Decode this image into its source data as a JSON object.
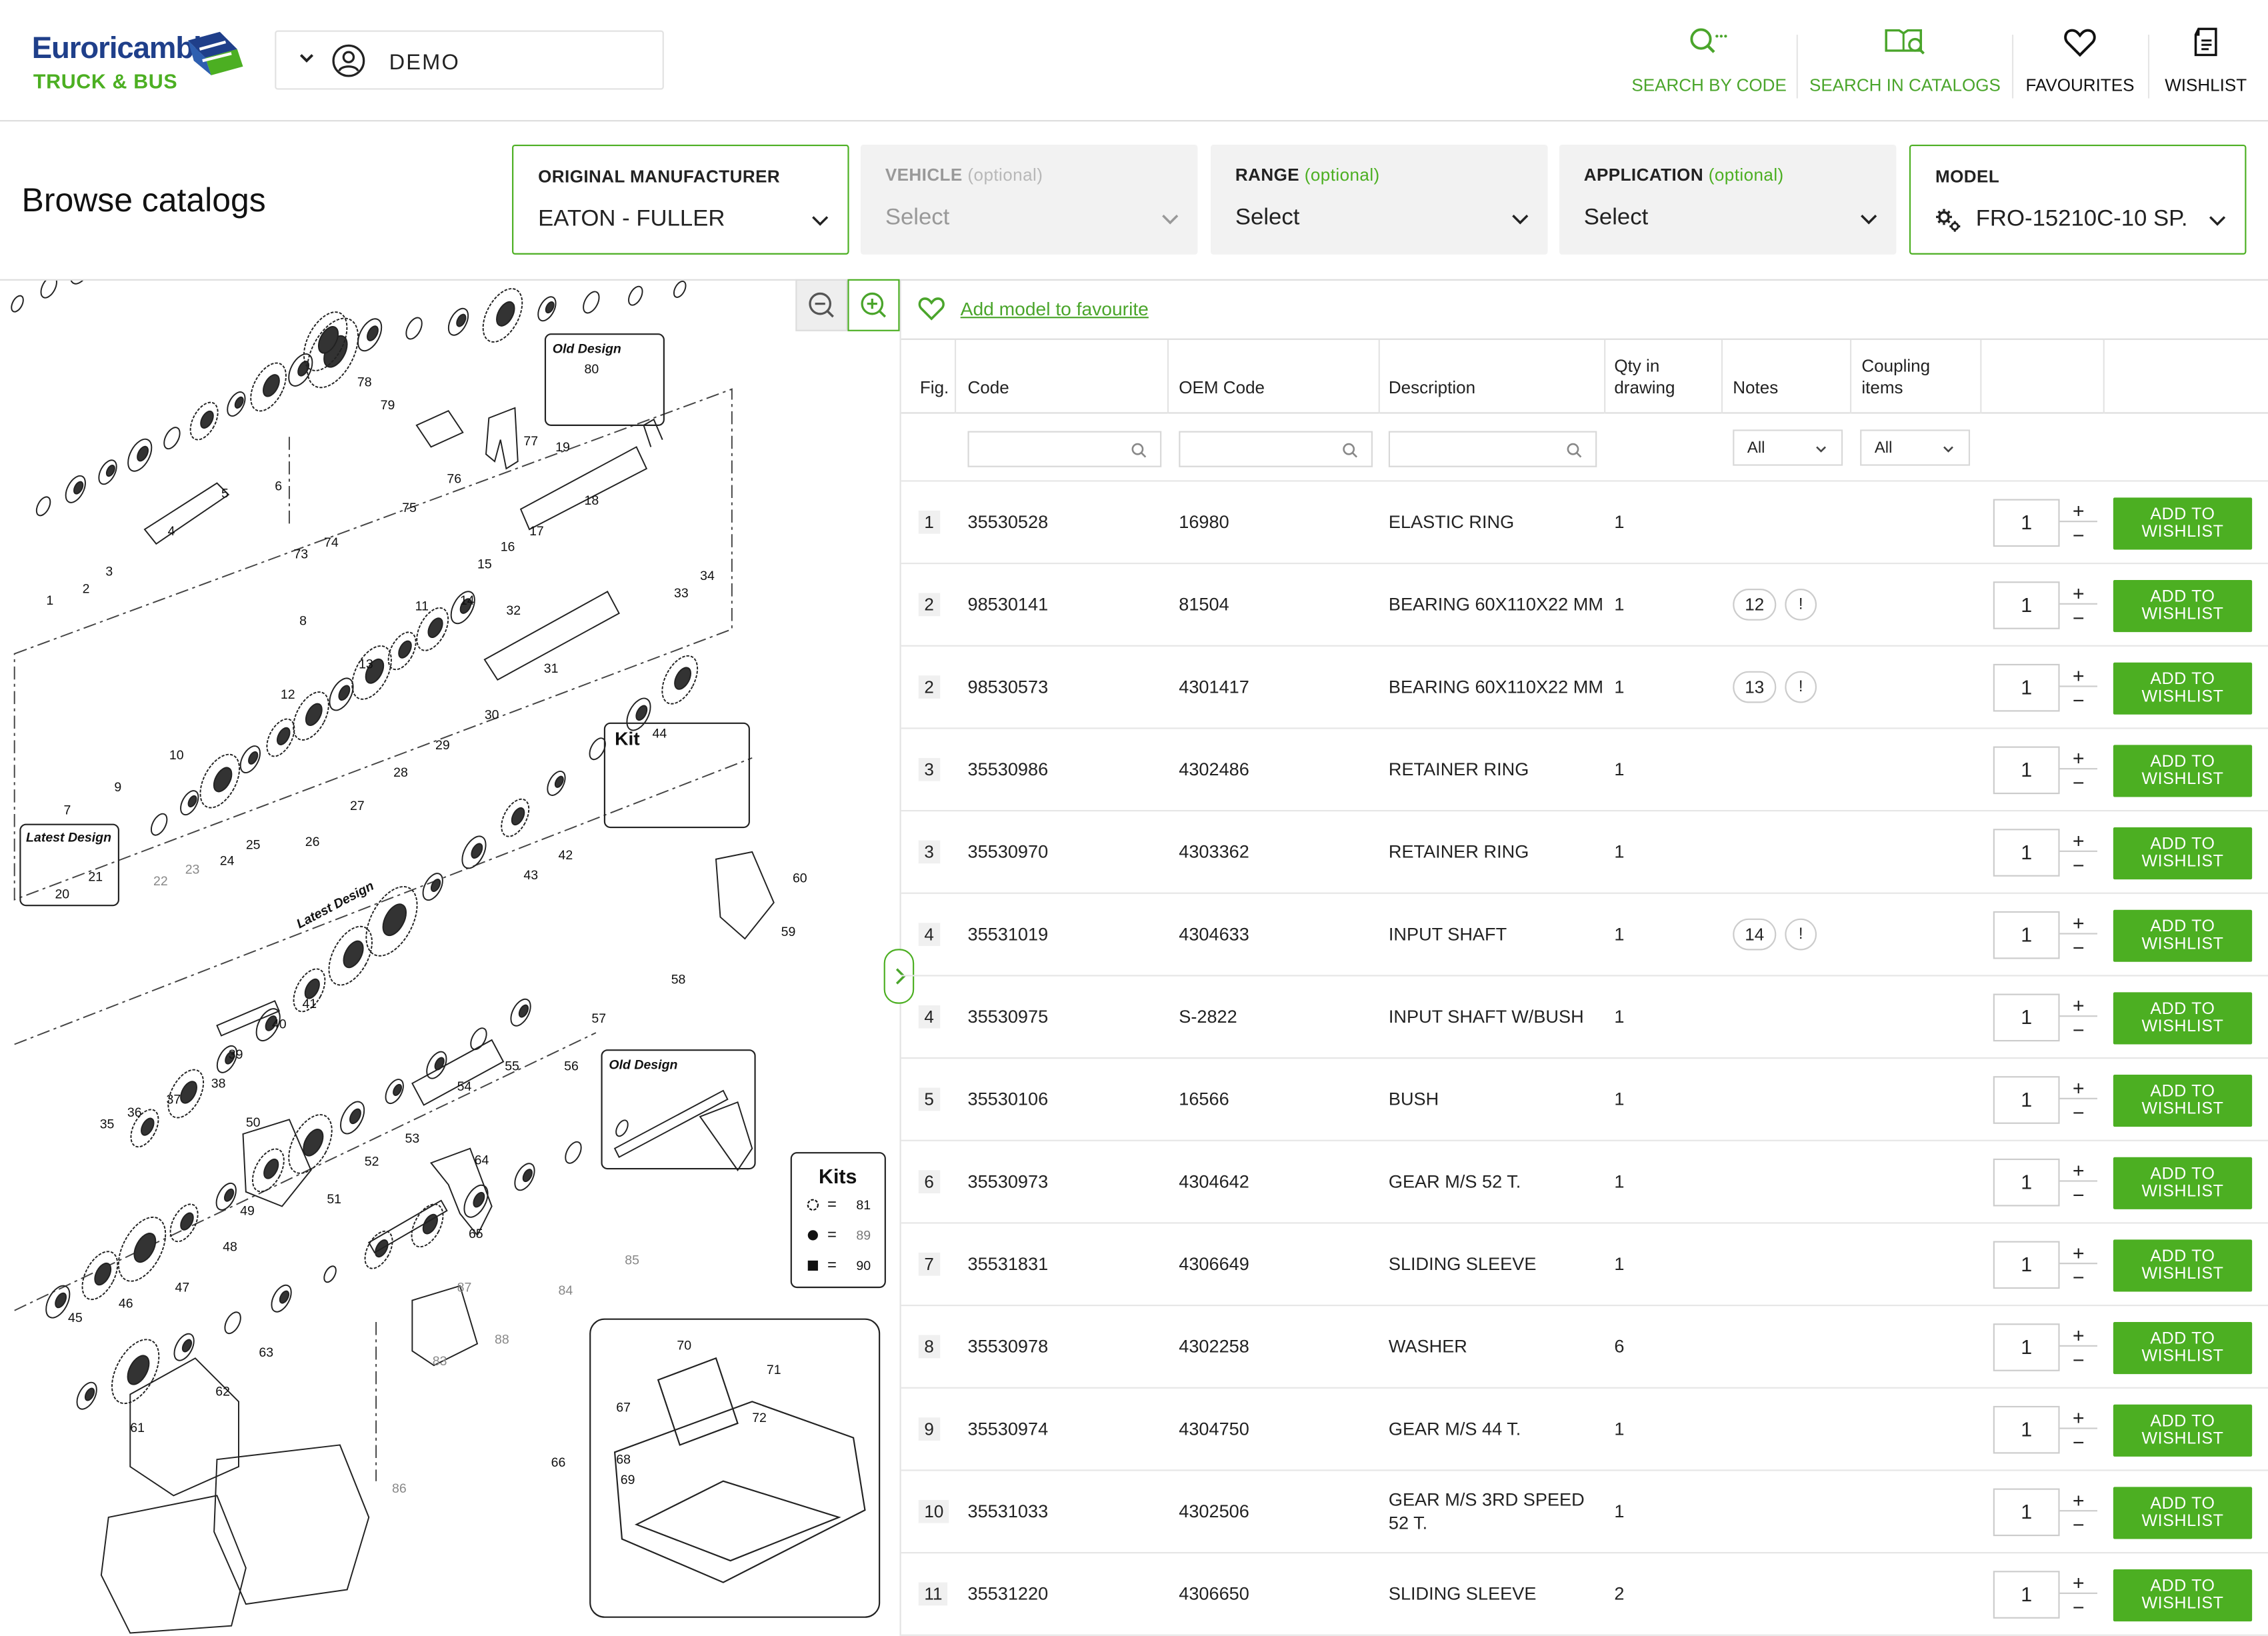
{
  "header": {
    "brand_line1": "Euroricambi",
    "brand_line2": "TRUCK & BUS",
    "user": "DEMO",
    "nav": [
      {
        "label": "SEARCH BY CODE",
        "icon": "search-code-icon"
      },
      {
        "label": "SEARCH IN CATALOGS",
        "icon": "catalog-search-icon"
      },
      {
        "label": "FAVOURITES",
        "icon": "heart-icon"
      },
      {
        "label": "WISHLIST",
        "icon": "wishlist-icon"
      }
    ]
  },
  "page": {
    "title": "Browse catalogs"
  },
  "filters": [
    {
      "label": "ORIGINAL MANUFACTURER",
      "optional": "",
      "value": "EATON - FULLER"
    },
    {
      "label": "VEHICLE",
      "optional": "(optional)",
      "value": "Select"
    },
    {
      "label": "RANGE",
      "optional": "(optional)",
      "value": "Select"
    },
    {
      "label": "APPLICATION",
      "optional": "(optional)",
      "value": "Select"
    },
    {
      "label": "MODEL",
      "optional": "",
      "value": "FRO-15210C-10 SP."
    }
  ],
  "favourite_link": "Add model to favourite",
  "table": {
    "columns": {
      "fig": "Fig.",
      "code": "Code",
      "oem": "OEM Code",
      "description": "Description",
      "qty_line1": "Qty in",
      "qty_line2": "drawing",
      "notes": "Notes",
      "coupling_line1": "Coupling",
      "coupling_line2": "items"
    },
    "notes_filter": "All",
    "coupling_filter": "All",
    "add_label_line1": "ADD TO",
    "add_label_line2": "WISHLIST",
    "plus": "+",
    "minus": "−",
    "rows": [
      {
        "fig": "1",
        "code": "35530528",
        "oem": "16980",
        "description": "ELASTIC RING",
        "qty": "1",
        "note": "",
        "qty_sel": "1"
      },
      {
        "fig": "2",
        "code": "98530141",
        "oem": "81504",
        "description": "BEARING 60X110X22 MM",
        "qty": "1",
        "note": "12",
        "qty_sel": "1"
      },
      {
        "fig": "2",
        "code": "98530573",
        "oem": "4301417",
        "description": "BEARING 60X110X22 MM",
        "qty": "1",
        "note": "13",
        "qty_sel": "1"
      },
      {
        "fig": "3",
        "code": "35530986",
        "oem": "4302486",
        "description": "RETAINER RING",
        "qty": "1",
        "note": "",
        "qty_sel": "1"
      },
      {
        "fig": "3",
        "code": "35530970",
        "oem": "4303362",
        "description": "RETAINER RING",
        "qty": "1",
        "note": "",
        "qty_sel": "1"
      },
      {
        "fig": "4",
        "code": "35531019",
        "oem": "4304633",
        "description": "INPUT SHAFT",
        "qty": "1",
        "note": "14",
        "qty_sel": "1"
      },
      {
        "fig": "4",
        "code": "35530975",
        "oem": "S-2822",
        "description": "INPUT SHAFT W/BUSH",
        "qty": "1",
        "note": "",
        "qty_sel": "1"
      },
      {
        "fig": "5",
        "code": "35530106",
        "oem": "16566",
        "description": "BUSH",
        "qty": "1",
        "note": "",
        "qty_sel": "1"
      },
      {
        "fig": "6",
        "code": "35530973",
        "oem": "4304642",
        "description": "GEAR M/S 52 T.",
        "qty": "1",
        "note": "",
        "qty_sel": "1"
      },
      {
        "fig": "7",
        "code": "35531831",
        "oem": "4306649",
        "description": "SLIDING SLEEVE",
        "qty": "1",
        "note": "",
        "qty_sel": "1"
      },
      {
        "fig": "8",
        "code": "35530978",
        "oem": "4302258",
        "description": "WASHER",
        "qty": "6",
        "note": "",
        "qty_sel": "1"
      },
      {
        "fig": "9",
        "code": "35530974",
        "oem": "4304750",
        "description": "GEAR M/S 44 T.",
        "qty": "1",
        "note": "",
        "qty_sel": "1"
      },
      {
        "fig": "10",
        "code": "35531033",
        "oem": "4302506",
        "description": "GEAR M/S 3RD SPEED 52 T.",
        "qty": "1",
        "note": "",
        "qty_sel": "1"
      },
      {
        "fig": "11",
        "code": "35531220",
        "oem": "4306650",
        "description": "SLIDING SLEEVE",
        "qty": "2",
        "note": "",
        "qty_sel": "1"
      }
    ]
  },
  "diagram": {
    "labels": {
      "old_design": "Old Design",
      "latest_design": "Latest Design",
      "latest_design_rot": "Latest Design",
      "kit": "Kit",
      "kits": "Kits",
      "eq": "="
    },
    "kits_legend": [
      {
        "symbol": "gear-outline",
        "num": "81"
      },
      {
        "symbol": "dot",
        "num": "89"
      },
      {
        "symbol": "square",
        "num": "90"
      }
    ],
    "part_numbers": [
      "1",
      "2",
      "3",
      "4",
      "5",
      "6",
      "7",
      "8",
      "9",
      "10",
      "11",
      "12",
      "13",
      "14",
      "15",
      "16",
      "17",
      "18",
      "19",
      "20",
      "21",
      "22",
      "23",
      "24",
      "25",
      "26",
      "27",
      "28",
      "29",
      "30",
      "31",
      "32",
      "33",
      "34",
      "35",
      "36",
      "37",
      "38",
      "39",
      "40",
      "41",
      "42",
      "43",
      "44",
      "45",
      "46",
      "47",
      "48",
      "49",
      "50",
      "51",
      "52",
      "53",
      "54",
      "55",
      "56",
      "57",
      "58",
      "59",
      "60",
      "61",
      "62",
      "63",
      "64",
      "65",
      "66",
      "67",
      "68",
      "69",
      "70",
      "71",
      "72",
      "73",
      "74",
      "75",
      "76",
      "77",
      "78",
      "79",
      "80",
      "83",
      "84",
      "85",
      "86",
      "87",
      "88"
    ]
  }
}
